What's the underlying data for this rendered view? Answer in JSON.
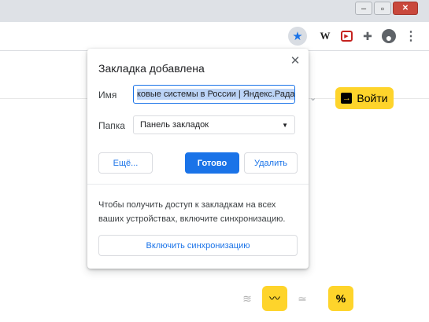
{
  "window": {
    "controls": [
      {
        "name": "minimize",
        "glyph": "–"
      },
      {
        "name": "maximize",
        "glyph": "▫"
      },
      {
        "name": "close",
        "glyph": "✕"
      }
    ]
  },
  "toolbar": {
    "star_glyph": "★",
    "ext_w_glyph": "W",
    "ext_red_glyph": "▶",
    "puzzle_glyph": "✚",
    "avatar_glyph": "●",
    "menu_glyph": "⋮"
  },
  "page": {
    "login_label": "Войти",
    "login_icon": "→",
    "chevron": "⌄",
    "mini_buttons": [
      {
        "name": "filter-icon",
        "glyph": "≋",
        "active": false
      },
      {
        "name": "chart-icon",
        "glyph": "〰",
        "active": true
      },
      {
        "name": "trend-icon",
        "glyph": "≃",
        "active": false
      },
      {
        "name": "percent-icon",
        "glyph": "%",
        "active": true
      }
    ]
  },
  "dialog": {
    "title": "Закладка добавлена",
    "close_glyph": "✕",
    "name_label": "Имя",
    "name_value": "ковые системы в России | Яндекс.Радар",
    "folder_label": "Папка",
    "folder_value": "Панель закладок",
    "folder_arrow": "▼",
    "more_button": "Ещё...",
    "done_button": "Готово",
    "delete_button": "Удалить",
    "sync_text": "Чтобы получить доступ к закладкам на всех ваших устройствах, включите синхронизацию.",
    "sync_button": "Включить синхронизацию"
  },
  "colors": {
    "accent": "#1a73e8",
    "yandex_yellow": "#fed42b",
    "window_close": "#c9483c"
  }
}
